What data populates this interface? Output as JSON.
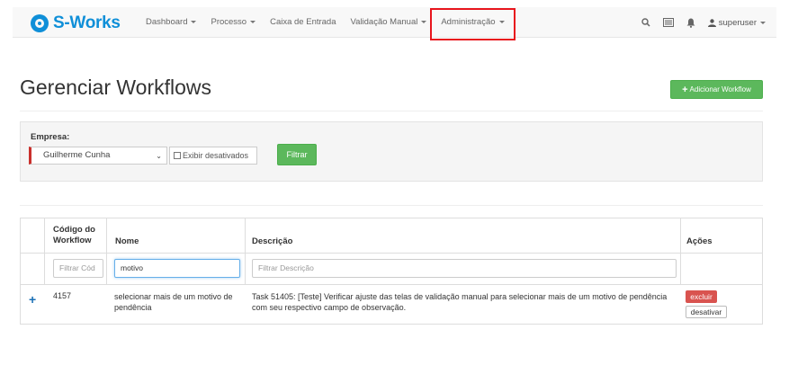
{
  "navbar": {
    "brand": "S-Works",
    "menu": [
      {
        "label": "Dashboard",
        "dropdown": true
      },
      {
        "label": "Processo",
        "dropdown": true
      },
      {
        "label": "Caixa de Entrada",
        "dropdown": false
      },
      {
        "label": "Validação Manual",
        "dropdown": true
      },
      {
        "label": "Administração",
        "dropdown": true,
        "highlighted": true
      }
    ],
    "icons": [
      "search-icon",
      "list-icon",
      "bell-icon",
      "user-icon"
    ],
    "user": "superuser",
    "colors": {
      "brand": "#0f8fd8",
      "highlight": "#e8151d"
    }
  },
  "header": {
    "title": "Gerenciar Workflows",
    "add_button": "Adicionar Workflow"
  },
  "filter": {
    "empresa_label": "Empresa:",
    "empresa_value": "Guilherme Cunha",
    "show_disabled_label": "Exibir desativados",
    "show_disabled_checked": false,
    "filter_button": "Filtrar"
  },
  "table": {
    "columns": [
      "Código do Workflow",
      "Nome",
      "Descrição",
      "Ações"
    ],
    "filters": {
      "codigo_placeholder": "Filtrar Cód",
      "nome_value": "motivo",
      "descricao_placeholder": "Filtrar Descrição"
    },
    "rows": [
      {
        "codigo": "4157",
        "nome": "selecionar mais de um motivo de pendência",
        "descricao": "Task 51405: [Teste] Verificar ajuste das telas de validação manual para selecionar mais de um motivo de pendência com seu respectivo campo de observação.",
        "actions": [
          "excluir",
          "desativar"
        ]
      }
    ]
  }
}
